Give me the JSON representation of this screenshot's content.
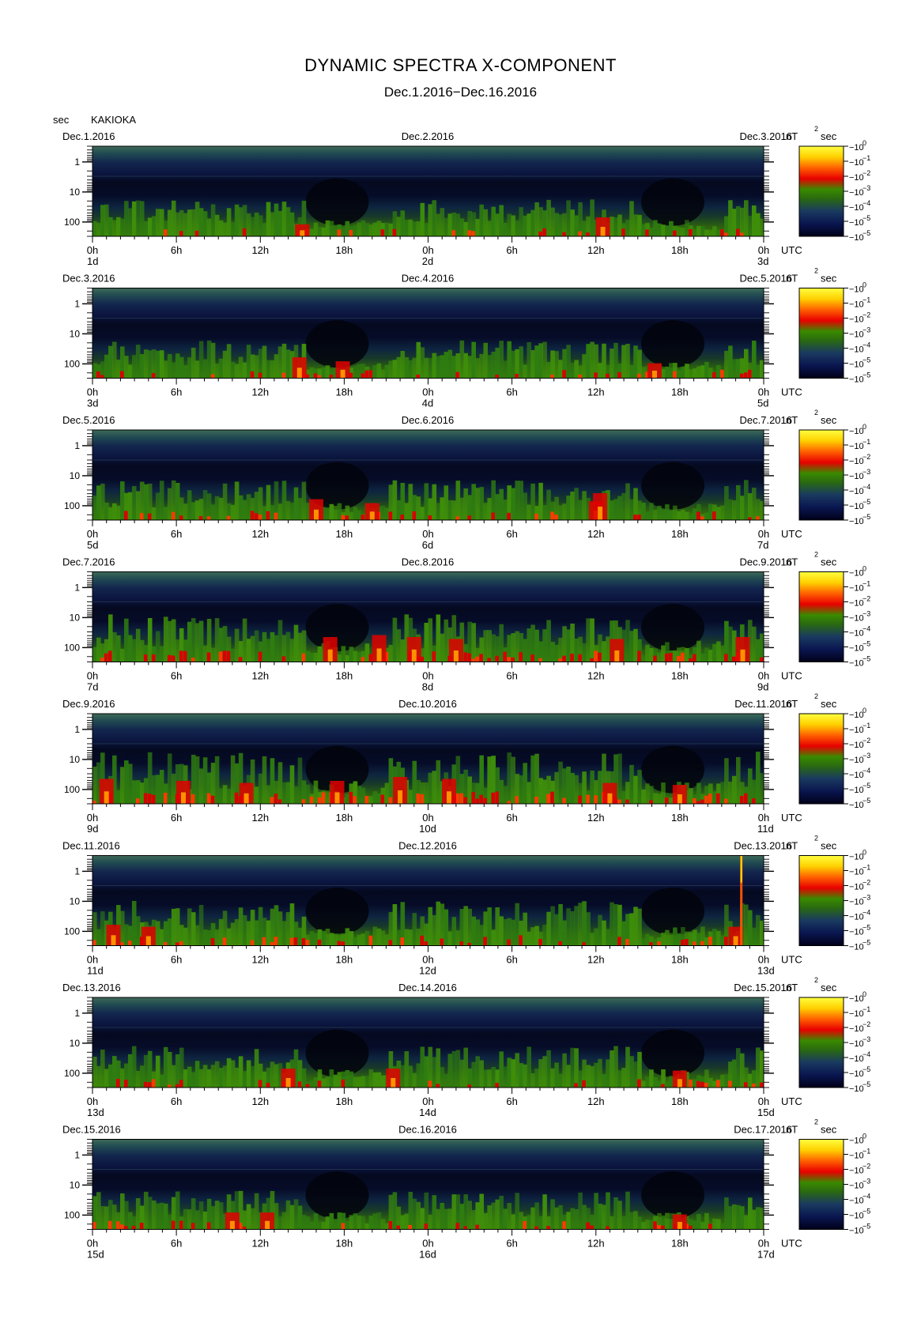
{
  "header": {
    "title": "DYNAMIC SPECTRA X-COMPONENT",
    "subtitle": "Dec.1.2016−Dec.16.2016",
    "y_unit": "sec",
    "station": "KAKIOKA"
  },
  "chart_data": {
    "type": "heatmap",
    "title": "DYNAMIC SPECTRA X-COMPONENT",
    "subtitle": "Dec.1.2016−Dec.16.2016",
    "ylabel": "sec",
    "yscale": "log",
    "yticks": [
      "1",
      "10",
      "100"
    ],
    "xticks": [
      "0h",
      "6h",
      "12h",
      "18h",
      "0h",
      "6h",
      "12h",
      "18h",
      "0h"
    ],
    "x_unit_label": "UTC",
    "colorbar": {
      "label": "nT",
      "exponent": "2",
      "unit": "sec",
      "base": "10",
      "ticks": [
        "0",
        "−1",
        "−2",
        "−3",
        "−4",
        "−5"
      ],
      "bottom_exponent": "−5",
      "colors": [
        "#000018",
        "#0a1650",
        "#1a3a60",
        "#2a6a10",
        "#3a8a00",
        "#e80000",
        "#ff6000",
        "#ffd000",
        "#ffff40"
      ]
    },
    "panels": [
      {
        "date_left": "Dec.1.2016",
        "date_mid": "Dec.2.2016",
        "date_right": "Dec.3.2016",
        "day_left": "1d",
        "day_mid": "2d",
        "day_right": "3d",
        "activity": 0.3,
        "red_events": [
          [
            15.0,
            0.15
          ],
          [
            36.5,
            0.5
          ]
        ],
        "spike": null
      },
      {
        "date_left": "Dec.3.2016",
        "date_mid": "Dec.4.2016",
        "date_right": "Dec.5.2016",
        "day_left": "3d",
        "day_mid": "4d",
        "day_right": "5d",
        "activity": 0.32,
        "red_events": [
          [
            14.8,
            0.6
          ],
          [
            17.9,
            0.4
          ],
          [
            40.2,
            0.3
          ]
        ],
        "spike": null
      },
      {
        "date_left": "Dec.5.2016",
        "date_mid": "Dec.6.2016",
        "date_right": "Dec.7.2016",
        "day_left": "5d",
        "day_mid": "6d",
        "day_right": "7d",
        "activity": 0.4,
        "red_events": [
          [
            16.0,
            0.6
          ],
          [
            20.0,
            0.4
          ],
          [
            36.0,
            0.5
          ],
          [
            36.3,
            0.9
          ]
        ],
        "spike": null
      },
      {
        "date_left": "Dec.7.2016",
        "date_mid": "Dec.8.2016",
        "date_right": "Dec.9.2016",
        "day_left": "7d",
        "day_mid": "8d",
        "day_right": "9d",
        "activity": 0.65,
        "red_events": [
          [
            17.0,
            0.8
          ],
          [
            20.5,
            0.9
          ],
          [
            23.0,
            0.8
          ],
          [
            26.0,
            0.7
          ],
          [
            37.5,
            0.7
          ],
          [
            46.5,
            0.8
          ]
        ],
        "spike": null
      },
      {
        "date_left": "Dec.9.2016",
        "date_mid": "Dec.10.2016",
        "date_right": "Dec.11.2016",
        "day_left": "9d",
        "day_mid": "10d",
        "day_right": "11d",
        "activity": 0.8,
        "red_events": [
          [
            1.0,
            0.8
          ],
          [
            6.5,
            0.7
          ],
          [
            11.0,
            0.6
          ],
          [
            17.5,
            0.7
          ],
          [
            22.0,
            0.9
          ],
          [
            25.5,
            0.8
          ],
          [
            37.0,
            0.6
          ],
          [
            42.0,
            0.5
          ]
        ],
        "spike": null
      },
      {
        "date_left": "Dec.11.2016",
        "date_mid": "Dec.12.2016",
        "date_right": "Dec.13.2016",
        "day_left": "11d",
        "day_mid": "12d",
        "day_right": "13d",
        "activity": 0.55,
        "red_events": [
          [
            1.5,
            0.6
          ],
          [
            4.0,
            0.5
          ],
          [
            46.0,
            0.5
          ]
        ],
        "spike": 46.4
      },
      {
        "date_left": "Dec.13.2016",
        "date_mid": "Dec.14.2016",
        "date_right": "Dec.15.2016",
        "day_left": "13d",
        "day_mid": "14d",
        "day_right": "15d",
        "activity": 0.45,
        "red_events": [
          [
            14.0,
            0.5
          ],
          [
            21.5,
            0.5
          ],
          [
            42.0,
            0.4
          ]
        ],
        "spike": null
      },
      {
        "date_left": "Dec.15.2016",
        "date_mid": "Dec.16.2016",
        "date_right": "Dec.17.2016",
        "day_left": "15d",
        "day_mid": "16d",
        "day_right": "17d",
        "activity": 0.35,
        "red_events": [
          [
            10.0,
            0.4
          ],
          [
            12.5,
            0.4
          ],
          [
            42.0,
            0.3
          ]
        ],
        "spike": null
      }
    ]
  }
}
